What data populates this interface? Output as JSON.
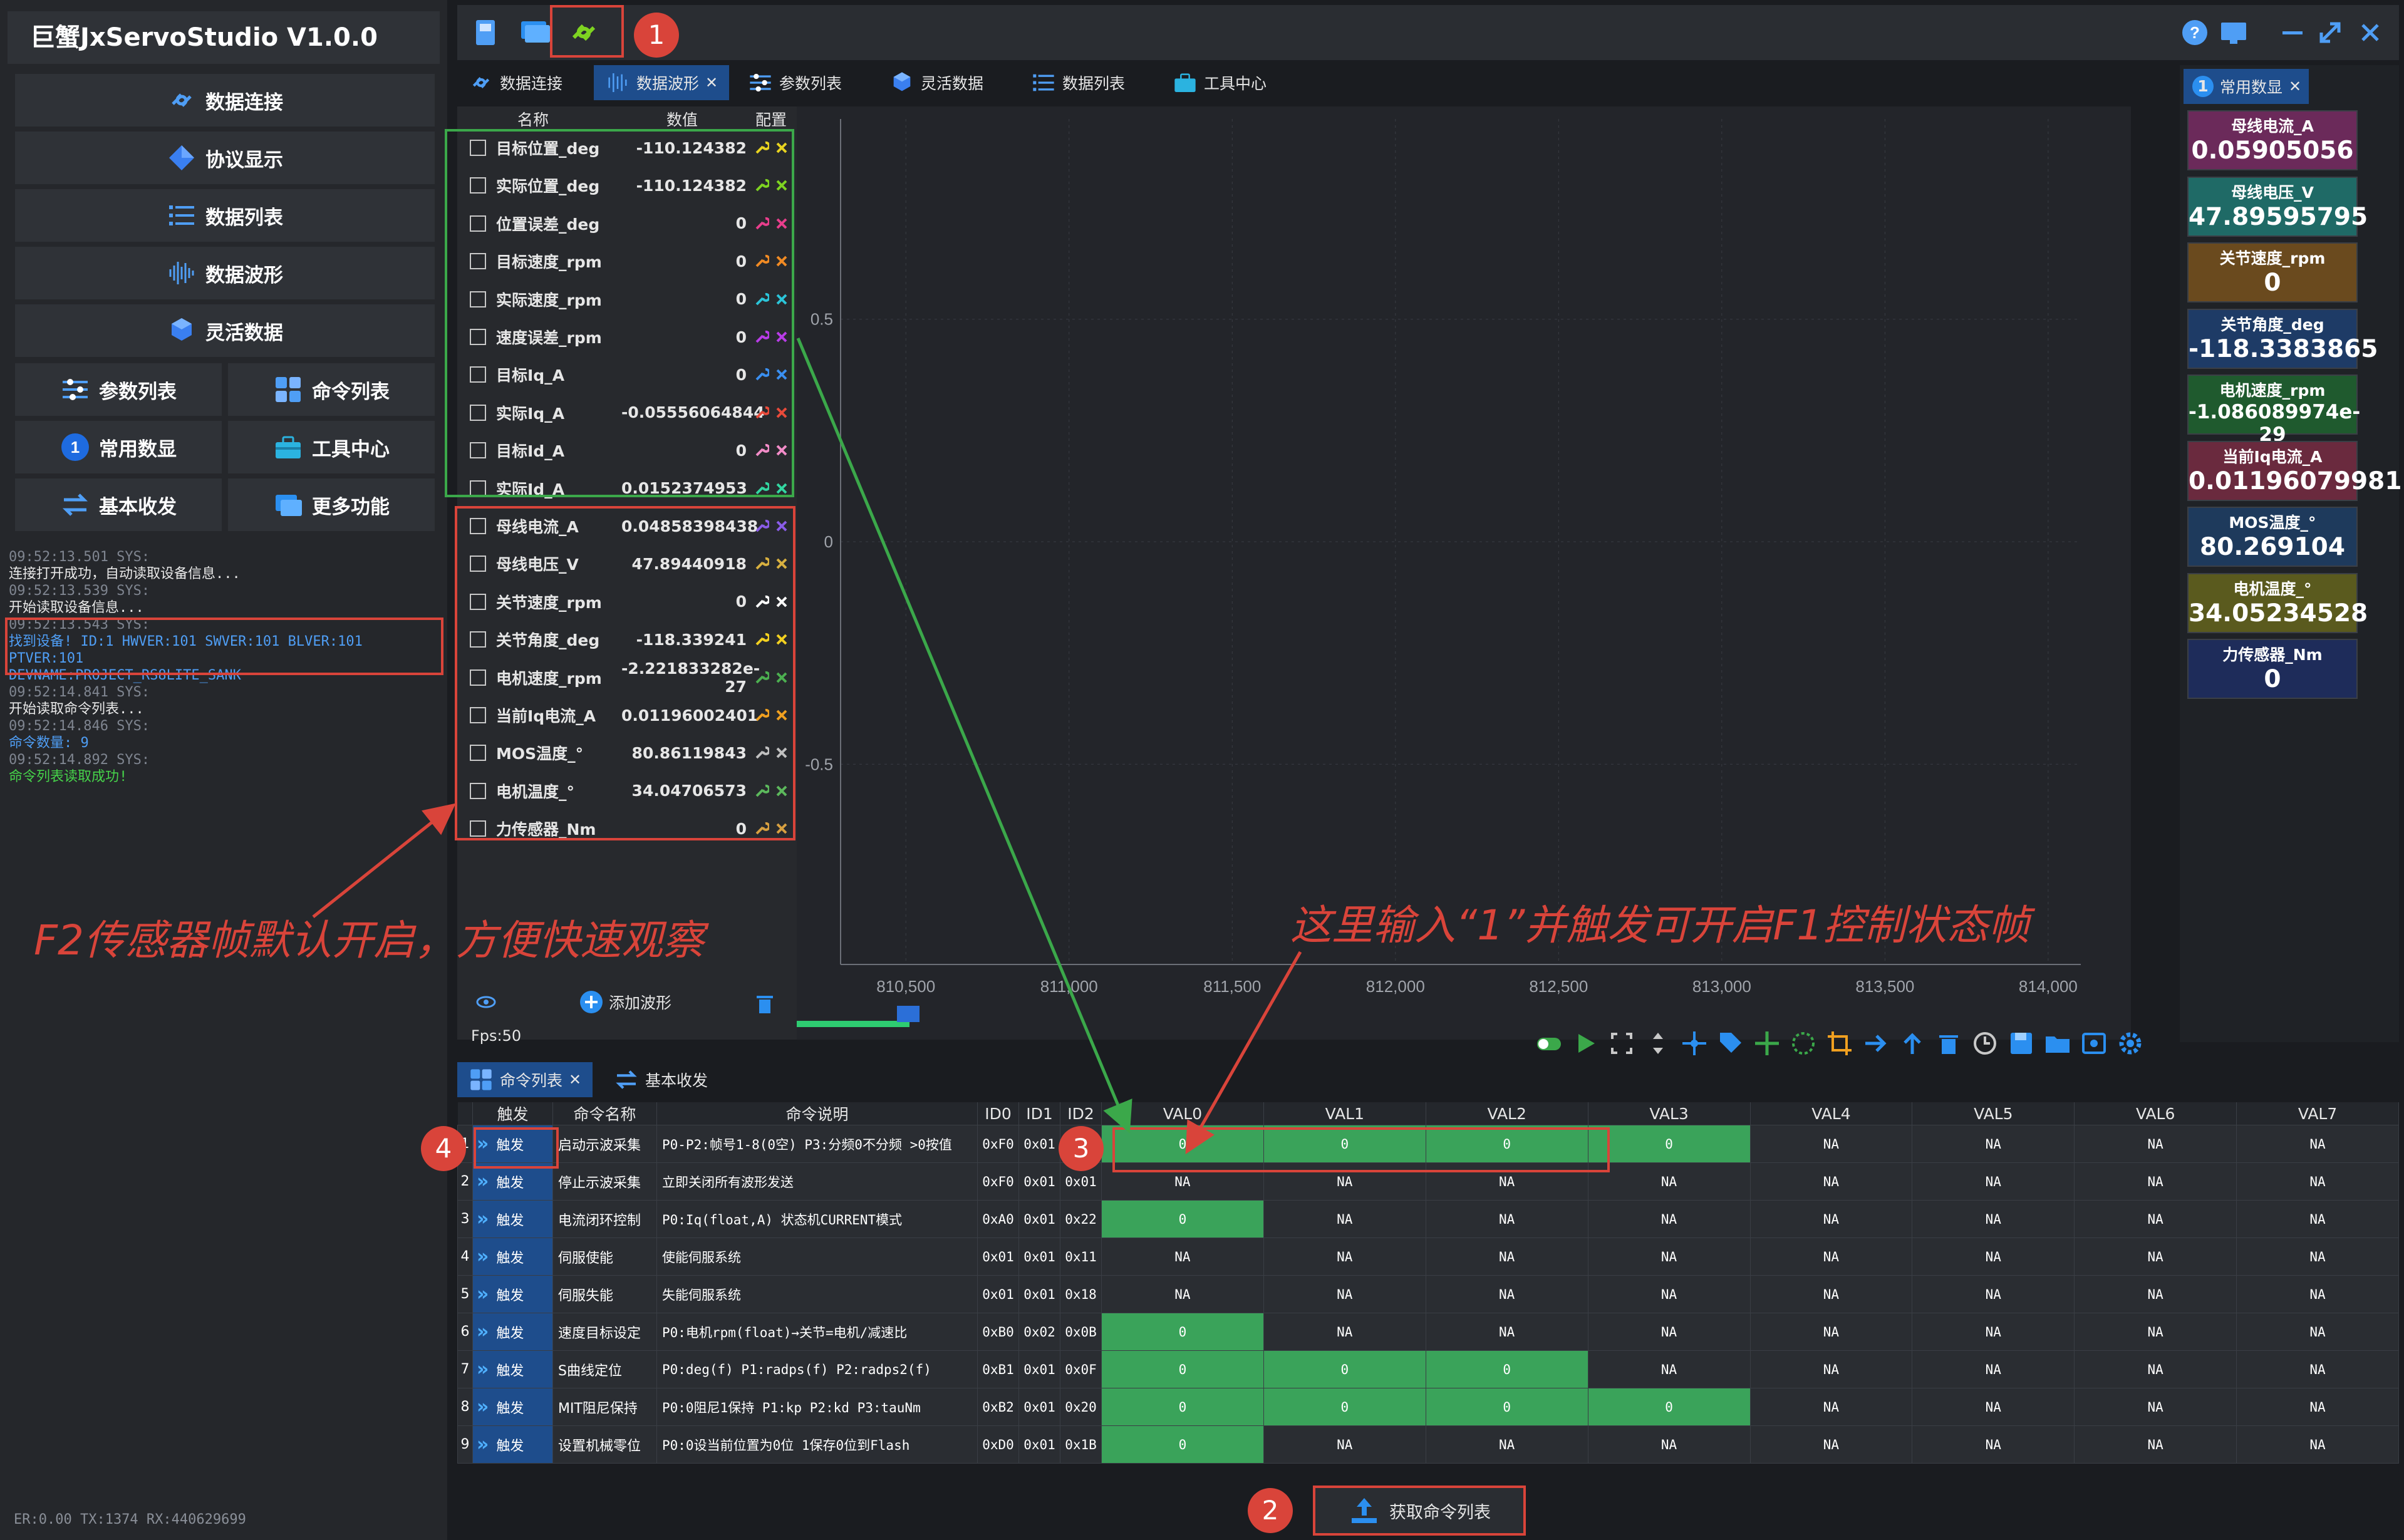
{
  "app": {
    "title": "巨蟹JxServoStudio   V1.0.0"
  },
  "left_nav": {
    "data_connect": "数据连接",
    "protocol_display": "协议显示",
    "data_list": "数据列表",
    "data_waveform": "数据波形",
    "flex_data": "灵活数据",
    "param_list": "参数列表",
    "command_list": "命令列表",
    "common_data": "常用数显",
    "tool_center": "工具中心",
    "basic_txrx": "基本收发",
    "more_features": "更多功能"
  },
  "log": [
    {
      "cls": "log-ts",
      "text": "09:52:13.501 SYS:"
    },
    {
      "cls": "log-w",
      "text": "连接打开成功，自动读取设备信息..."
    },
    {
      "cls": "log-ts",
      "text": "09:52:13.539 SYS:"
    },
    {
      "cls": "log-w",
      "text": "开始读取设备信息..."
    },
    {
      "cls": "log-ts",
      "text": "09:52:13.543 SYS:"
    },
    {
      "cls": "log-b",
      "text": "找到设备! ID:1 HWVER:101 SWVER:101 BLVER:101 PTVER:101"
    },
    {
      "cls": "log-b",
      "text": "DEVNAME:PROJECT_RS8LITE_SANK"
    },
    {
      "cls": "log-ts",
      "text": "09:52:14.841 SYS:"
    },
    {
      "cls": "log-w",
      "text": "开始读取命令列表..."
    },
    {
      "cls": "log-ts",
      "text": "09:52:14.846 SYS:"
    },
    {
      "cls": "log-b",
      "text": "命令数量: 9"
    },
    {
      "cls": "log-ts",
      "text": "09:52:14.892 SYS:"
    },
    {
      "cls": "log-g",
      "text": "命令列表读取成功!"
    }
  ],
  "status_bar": "ER:0.00 TX:1374 RX:440629699",
  "top_tabs": [
    "数据连接",
    "数据波形",
    "参数列表",
    "灵活数据",
    "数据列表",
    "工具中心"
  ],
  "signal_panel": {
    "headers": {
      "name": "名称",
      "value": "数值",
      "config": "配置"
    },
    "signals": [
      {
        "name": "目标位置_deg",
        "value": "-110.124382",
        "color": "#e8d320"
      },
      {
        "name": "实际位置_deg",
        "value": "-110.124382",
        "color": "#7ed321"
      },
      {
        "name": "位置误差_deg",
        "value": "0",
        "color": "#e83e8c"
      },
      {
        "name": "目标速度_rpm",
        "value": "0",
        "color": "#f08a24"
      },
      {
        "name": "实际速度_rpm",
        "value": "0",
        "color": "#2bc4d8"
      },
      {
        "name": "速度误差_rpm",
        "value": "0",
        "color": "#b93ce8"
      },
      {
        "name": "目标Iq_A",
        "value": "0",
        "color": "#3a8ff0"
      },
      {
        "name": "实际Iq_A",
        "value": "-0.05556064844",
        "color": "#e84a3a"
      },
      {
        "name": "目标Id_A",
        "value": "0",
        "color": "#f28cc8"
      },
      {
        "name": "实际Id_A",
        "value": "0.0152374953",
        "color": "#33d6a0"
      },
      {
        "name": "母线电流_A",
        "value": "0.04858398438",
        "color": "#8a5ce8"
      },
      {
        "name": "母线电压_V",
        "value": "47.89440918",
        "color": "#d8b040"
      },
      {
        "name": "关节速度_rpm",
        "value": "0",
        "color": "#ffffff"
      },
      {
        "name": "关节角度_deg",
        "value": "-118.339241",
        "color": "#f2d020"
      },
      {
        "name": "电机速度_rpm",
        "value": "-2.221833282e-27",
        "color": "#4caf50"
      },
      {
        "name": "当前Iq电流_A",
        "value": "0.01196002401",
        "color": "#f0a020"
      },
      {
        "name": "MOS温度_°",
        "value": "80.86119843",
        "color": "#c0c0c0"
      },
      {
        "name": "电机温度_°",
        "value": "34.04706573",
        "color": "#5cb85c"
      },
      {
        "name": "力传感器_Nm",
        "value": "0",
        "color": "#d8a040"
      }
    ],
    "add_wave": "添加波形",
    "fps": "Fps:50"
  },
  "chart_data": {
    "type": "line",
    "series": [],
    "xlim": [
      810300,
      814100
    ],
    "ylim": [
      -0.95,
      0.95
    ],
    "x_ticks": [
      "810,500",
      "811,000",
      "811,500",
      "812,000",
      "812,500",
      "813,000",
      "813,500",
      "814,000"
    ],
    "y_ticks": [
      "0.5",
      "0",
      "-0.5"
    ],
    "grid": true
  },
  "right_panel": {
    "tab_label": "常用数显",
    "tab_number": "1",
    "cards": [
      {
        "label": "母线电流_A",
        "value": "0.05905056",
        "bg": "#6b2a5a"
      },
      {
        "label": "母线电压_V",
        "value": "47.89595795",
        "bg": "#1f6a66"
      },
      {
        "label": "关节速度_rpm",
        "value": "0",
        "bg": "#6a4a1e"
      },
      {
        "label": "关节角度_deg",
        "value": "-118.3383865",
        "bg": "#1e3b66"
      },
      {
        "label": "电机速度_rpm",
        "value": "-1.086089974e-29",
        "bg": "#1f5a2e"
      },
      {
        "label": "当前Iq电流_A",
        "value": "0.01196079981",
        "bg": "#6a2a3e"
      },
      {
        "label": "MOS温度_°",
        "value": "80.269104",
        "bg": "#1e3a5c"
      },
      {
        "label": "电机温度_°",
        "value": "34.05234528",
        "bg": "#5a5a1e"
      },
      {
        "label": "力传感器_Nm",
        "value": "0",
        "bg": "#1e2c5a"
      }
    ]
  },
  "bottom_tabs": [
    "命令列表",
    "基本收发"
  ],
  "cmd_table": {
    "headers": [
      "触发",
      "命令名称",
      "命令说明",
      "ID0",
      "ID1",
      "ID2",
      "VAL0",
      "VAL1",
      "VAL2",
      "VAL3",
      "VAL4",
      "VAL5",
      "VAL6",
      "VAL7"
    ],
    "trigger_label": "触发",
    "rows": [
      {
        "no": "1",
        "name": "启动示波采集",
        "desc": "P0-P2:帧号1-8(0空) P3:分频0不分频 >0按值",
        "id0": "0xF0",
        "id1": "0x01",
        "id2": "0x00",
        "vals": [
          "0",
          "0",
          "0",
          "0",
          "NA",
          "NA",
          "NA",
          "NA"
        ],
        "green": [
          1,
          1,
          1,
          1,
          0,
          0,
          0,
          0
        ]
      },
      {
        "no": "2",
        "name": "停止示波采集",
        "desc": "立即关闭所有波形发送",
        "id0": "0xF0",
        "id1": "0x01",
        "id2": "0x01",
        "vals": [
          "NA",
          "NA",
          "NA",
          "NA",
          "NA",
          "NA",
          "NA",
          "NA"
        ],
        "green": [
          0,
          0,
          0,
          0,
          0,
          0,
          0,
          0
        ]
      },
      {
        "no": "3",
        "name": "电流闭环控制",
        "desc": "P0:Iq(float,A) 状态机CURRENT模式",
        "id0": "0xA0",
        "id1": "0x01",
        "id2": "0x22",
        "vals": [
          "0",
          "NA",
          "NA",
          "NA",
          "NA",
          "NA",
          "NA",
          "NA"
        ],
        "green": [
          1,
          0,
          0,
          0,
          0,
          0,
          0,
          0
        ]
      },
      {
        "no": "4",
        "name": "伺服使能",
        "desc": "使能伺服系统",
        "id0": "0x01",
        "id1": "0x01",
        "id2": "0x11",
        "vals": [
          "NA",
          "NA",
          "NA",
          "NA",
          "NA",
          "NA",
          "NA",
          "NA"
        ],
        "green": [
          0,
          0,
          0,
          0,
          0,
          0,
          0,
          0
        ]
      },
      {
        "no": "5",
        "name": "伺服失能",
        "desc": "失能伺服系统",
        "id0": "0x01",
        "id1": "0x01",
        "id2": "0x18",
        "vals": [
          "NA",
          "NA",
          "NA",
          "NA",
          "NA",
          "NA",
          "NA",
          "NA"
        ],
        "green": [
          0,
          0,
          0,
          0,
          0,
          0,
          0,
          0
        ]
      },
      {
        "no": "6",
        "name": "速度目标设定",
        "desc": "P0:电机rpm(float)→关节=电机/减速比",
        "id0": "0xB0",
        "id1": "0x02",
        "id2": "0x0B",
        "vals": [
          "0",
          "NA",
          "NA",
          "NA",
          "NA",
          "NA",
          "NA",
          "NA"
        ],
        "green": [
          1,
          0,
          0,
          0,
          0,
          0,
          0,
          0
        ]
      },
      {
        "no": "7",
        "name": "S曲线定位",
        "desc": "P0:deg(f) P1:radps(f) P2:radps2(f)",
        "id0": "0xB1",
        "id1": "0x01",
        "id2": "0x0F",
        "vals": [
          "0",
          "0",
          "0",
          "NA",
          "NA",
          "NA",
          "NA",
          "NA"
        ],
        "green": [
          1,
          1,
          1,
          0,
          0,
          0,
          0,
          0
        ]
      },
      {
        "no": "8",
        "name": "MIT阻尼保持",
        "desc": "P0:0阻尼1保持 P1:kp P2:kd P3:tauNm",
        "id0": "0xB2",
        "id1": "0x01",
        "id2": "0x20",
        "vals": [
          "0",
          "0",
          "0",
          "0",
          "NA",
          "NA",
          "NA",
          "NA"
        ],
        "green": [
          1,
          1,
          1,
          1,
          0,
          0,
          0,
          0
        ]
      },
      {
        "no": "9",
        "name": "设置机械零位",
        "desc": "P0:0设当前位置为0位 1保存0位到Flash",
        "id0": "0xD0",
        "id1": "0x01",
        "id2": "0x1B",
        "vals": [
          "0",
          "NA",
          "NA",
          "NA",
          "NA",
          "NA",
          "NA",
          "NA"
        ],
        "green": [
          1,
          0,
          0,
          0,
          0,
          0,
          0,
          0
        ]
      }
    ]
  },
  "get_cmd_button": "获取命令列表",
  "annotations": {
    "badge1": "1",
    "badge2": "2",
    "badge3": "3",
    "badge4": "4",
    "text_left": "F2传感器帧默认开启，方便快速观察",
    "text_right": "这里输入“1”并触发可开启F1控制状态帧"
  },
  "colors": {
    "accent": "#1e4d8c",
    "highlight_red": "#d9443a",
    "highlight_green": "#3ba84a",
    "cell_green": "#3aa35a"
  }
}
